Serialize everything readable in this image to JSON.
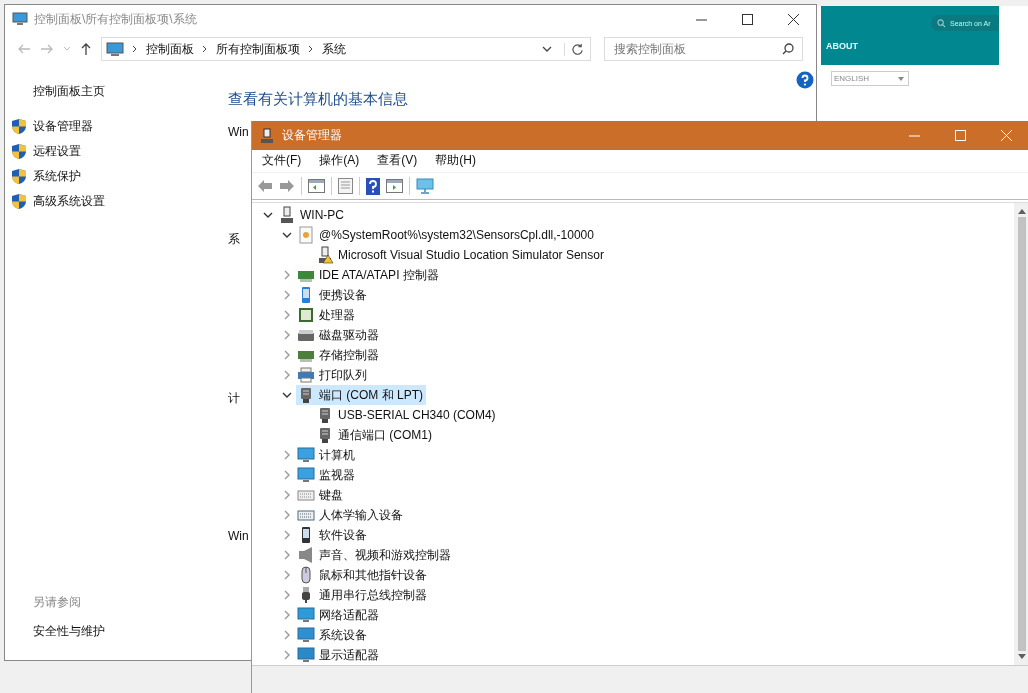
{
  "control_panel": {
    "title": "控制面板\\所有控制面板项\\系统",
    "breadcrumb": [
      "控制面板",
      "所有控制面板项",
      "系统"
    ],
    "search": {
      "placeholder": "搜索控制面板"
    },
    "home_link": "控制面板主页",
    "nav_items": [
      "设备管理器",
      "远程设置",
      "系统保护",
      "高级系统设置"
    ],
    "heading": "查看有关计算机的基本信息",
    "section_fragments": [
      "Win",
      "系",
      "计",
      "Win"
    ],
    "see_also": {
      "title": "另请参阅",
      "links": [
        "安全性与维护"
      ]
    }
  },
  "browser": {
    "search": {
      "placeholder": "Search on Ar"
    },
    "nav_item": "ABOUT",
    "language": "ENGLISH"
  },
  "device_manager": {
    "title": "设备管理器",
    "menu": [
      "文件(F)",
      "操作(A)",
      "查看(V)",
      "帮助(H)"
    ],
    "tree": [
      {
        "label": "WIN-PC",
        "kind": "computer",
        "expanded": true,
        "selected": false,
        "children": [
          {
            "label": "@%SystemRoot%\\system32\\SensorsCpl.dll,-10000",
            "kind": "sensor",
            "expanded": true,
            "selected": false,
            "children": [
              {
                "label": "Microsoft Visual Studio Location Simulator Sensor",
                "kind": "sensor-device",
                "selected": false,
                "warning": true
              }
            ]
          },
          {
            "label": "IDE ATA/ATAPI 控制器",
            "kind": "ide",
            "expanded": false,
            "selected": false
          },
          {
            "label": "便携设备",
            "kind": "portable",
            "expanded": false,
            "selected": false
          },
          {
            "label": "处理器",
            "kind": "cpu",
            "expanded": false,
            "selected": false
          },
          {
            "label": "磁盘驱动器",
            "kind": "disk",
            "expanded": false,
            "selected": false
          },
          {
            "label": "存储控制器",
            "kind": "storage",
            "expanded": false,
            "selected": false
          },
          {
            "label": "打印队列",
            "kind": "printer",
            "expanded": false,
            "selected": false
          },
          {
            "label": "端口 (COM 和 LPT)",
            "kind": "port",
            "expanded": true,
            "selected": true,
            "children": [
              {
                "label": "USB-SERIAL CH340 (COM4)",
                "kind": "port",
                "selected": false
              },
              {
                "label": "通信端口 (COM1)",
                "kind": "port",
                "selected": false
              }
            ]
          },
          {
            "label": "计算机",
            "kind": "monitor",
            "expanded": false,
            "selected": false
          },
          {
            "label": "监视器",
            "kind": "monitor",
            "expanded": false,
            "selected": false
          },
          {
            "label": "键盘",
            "kind": "keyboard",
            "expanded": false,
            "selected": false
          },
          {
            "label": "人体学输入设备",
            "kind": "hid",
            "expanded": false,
            "selected": false
          },
          {
            "label": "软件设备",
            "kind": "software",
            "expanded": false,
            "selected": false
          },
          {
            "label": "声音、视频和游戏控制器",
            "kind": "sound",
            "expanded": false,
            "selected": false
          },
          {
            "label": "鼠标和其他指针设备",
            "kind": "mouse",
            "expanded": false,
            "selected": false
          },
          {
            "label": "通用串行总线控制器",
            "kind": "usb",
            "expanded": false,
            "selected": false
          },
          {
            "label": "网络适配器",
            "kind": "network",
            "expanded": false,
            "selected": false
          },
          {
            "label": "系统设备",
            "kind": "system",
            "expanded": false,
            "selected": false
          },
          {
            "label": "显示适配器",
            "kind": "display",
            "expanded": false,
            "selected": false
          }
        ]
      }
    ]
  }
}
